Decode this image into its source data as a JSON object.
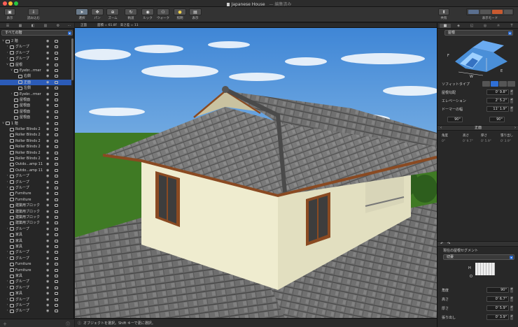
{
  "window": {
    "title": "Japanese House",
    "subtitle": "— 編集済み"
  },
  "toolbar": {
    "left_buttons": [
      {
        "label": "表示",
        "icon": "view-icon"
      },
      {
        "label": "読み込む",
        "icon": "import-icon"
      }
    ],
    "center_buttons": [
      {
        "label": "選択",
        "icon": "select-icon"
      },
      {
        "label": "パン",
        "icon": "pan-icon"
      },
      {
        "label": "ズーム",
        "icon": "zoom-icon"
      },
      {
        "label": "軌道",
        "icon": "orbit-icon"
      },
      {
        "label": "ルック",
        "icon": "look-icon"
      },
      {
        "label": "ウォーク",
        "icon": "walk-icon"
      },
      {
        "label": "照明",
        "icon": "lighting-icon"
      },
      {
        "label": "表示",
        "icon": "display-icon"
      }
    ],
    "right_buttons": [
      {
        "label": "共有",
        "icon": "share-icon"
      },
      {
        "label": "表示モード",
        "icon": "view-mode-icon"
      }
    ]
  },
  "left_panel": {
    "filter": "すべての階",
    "tree": [
      {
        "indent": 0,
        "tri": "∨",
        "label": "2 階",
        "selected": false
      },
      {
        "indent": 1,
        "tri": "›",
        "label": "グループ",
        "selected": false
      },
      {
        "indent": 1,
        "tri": "›",
        "label": "グループ",
        "selected": false
      },
      {
        "indent": 1,
        "tri": "›",
        "label": "グループ",
        "selected": false
      },
      {
        "indent": 1,
        "tri": "∨",
        "label": "屋根",
        "selected": false
      },
      {
        "indent": 2,
        "tri": "∨",
        "label": "Eyebr...rmer",
        "selected": false
      },
      {
        "indent": 3,
        "tri": "",
        "label": "右側",
        "selected": false
      },
      {
        "indent": 3,
        "tri": "",
        "label": "正面",
        "selected": true
      },
      {
        "indent": 3,
        "tri": "",
        "label": "左側",
        "selected": false
      },
      {
        "indent": 2,
        "tri": "›",
        "label": "Eyebr...rmer",
        "selected": false
      },
      {
        "indent": 2,
        "tri": "",
        "label": "屋根面",
        "selected": false
      },
      {
        "indent": 2,
        "tri": "",
        "label": "屋根面",
        "selected": false
      },
      {
        "indent": 2,
        "tri": "",
        "label": "屋根面",
        "selected": false
      },
      {
        "indent": 2,
        "tri": "",
        "label": "屋根面",
        "selected": false
      },
      {
        "indent": 0,
        "tri": "∨",
        "label": "1 階",
        "selected": false
      },
      {
        "indent": 1,
        "tri": "",
        "label": "Roller Blinds 2",
        "selected": false
      },
      {
        "indent": 1,
        "tri": "",
        "label": "Roller Blinds 2",
        "selected": false
      },
      {
        "indent": 1,
        "tri": "",
        "label": "Roller Blinds 2",
        "selected": false
      },
      {
        "indent": 1,
        "tri": "",
        "label": "Roller Blinds 2",
        "selected": false
      },
      {
        "indent": 1,
        "tri": "",
        "label": "Roller Blinds 2",
        "selected": false
      },
      {
        "indent": 1,
        "tri": "",
        "label": "Roller Blinds 2",
        "selected": false
      },
      {
        "indent": 1,
        "tri": "",
        "label": "Outdo...amp 11",
        "selected": false
      },
      {
        "indent": 1,
        "tri": "",
        "label": "Outdo...amp 11",
        "selected": false
      },
      {
        "indent": 1,
        "tri": "›",
        "label": "グループ",
        "selected": false
      },
      {
        "indent": 1,
        "tri": "›",
        "label": "グループ",
        "selected": false
      },
      {
        "indent": 1,
        "tri": "›",
        "label": "グループ",
        "selected": false
      },
      {
        "indent": 1,
        "tri": "",
        "label": "Furniture",
        "selected": false
      },
      {
        "indent": 1,
        "tri": "",
        "label": "Furniture",
        "selected": false
      },
      {
        "indent": 1,
        "tri": "",
        "label": "建築用ブロック",
        "selected": false
      },
      {
        "indent": 1,
        "tri": "",
        "label": "建築用ブロック",
        "selected": false
      },
      {
        "indent": 1,
        "tri": "",
        "label": "建築用ブロック",
        "selected": false
      },
      {
        "indent": 1,
        "tri": "",
        "label": "建築用ブロック",
        "selected": false
      },
      {
        "indent": 1,
        "tri": "›",
        "label": "グループ",
        "selected": false
      },
      {
        "indent": 1,
        "tri": "",
        "label": "家具",
        "selected": false
      },
      {
        "indent": 1,
        "tri": "",
        "label": "家具",
        "selected": false
      },
      {
        "indent": 1,
        "tri": "",
        "label": "家具",
        "selected": false
      },
      {
        "indent": 1,
        "tri": "›",
        "label": "グループ",
        "selected": false
      },
      {
        "indent": 1,
        "tri": "›",
        "label": "グループ",
        "selected": false
      },
      {
        "indent": 1,
        "tri": "",
        "label": "Furniture",
        "selected": false
      },
      {
        "indent": 1,
        "tri": "",
        "label": "Furniture",
        "selected": false
      },
      {
        "indent": 1,
        "tri": "",
        "label": "家具",
        "selected": false
      },
      {
        "indent": 1,
        "tri": "›",
        "label": "グループ",
        "selected": false
      },
      {
        "indent": 1,
        "tri": "›",
        "label": "グループ",
        "selected": false
      },
      {
        "indent": 1,
        "tri": "",
        "label": "家具",
        "selected": false
      },
      {
        "indent": 1,
        "tri": "›",
        "label": "グループ",
        "selected": false
      },
      {
        "indent": 1,
        "tri": "›",
        "label": "グループ",
        "selected": false
      },
      {
        "indent": 1,
        "tri": "›",
        "label": "グループ",
        "selected": false
      }
    ]
  },
  "viewport": {
    "header_name": "正面",
    "header_info": "面積 = 61.8F　高さ差 = 11"
  },
  "statusbar": {
    "text": "オブジェクトを選択。Shift キーで更に選択。"
  },
  "right_panel": {
    "object_type": "屋根",
    "diagram_labels": {
      "f": "F",
      "w": "W",
      "e": "E"
    },
    "soffit_label": "ソフィットタイプ",
    "properties": [
      {
        "label": "屋根勾配",
        "value": "0' 9.8\""
      },
      {
        "label": "エレベーション",
        "value": "2' 5.2\""
      },
      {
        "label": "ドーマーの幅",
        "value": "11' 1.9\""
      }
    ],
    "angle_left": "90°",
    "angle_right": "90°",
    "face_selector": "正面",
    "table_headers": [
      "角度",
      "高さ",
      "厚さ",
      "張り出し"
    ],
    "table_row": [
      "0°",
      "0' 9.7\"",
      "0' 5.9\"",
      "0' 3.9\""
    ],
    "segment_header": "現在の屋根セグメント",
    "segment_material": "切妻",
    "segment_dims": {
      "h": "H",
      "o": "O"
    },
    "segment_props": [
      {
        "label": "角度",
        "value": "90°"
      },
      {
        "label": "高さ",
        "value": "0' 6.7\""
      },
      {
        "label": "厚さ",
        "value": "0' 5.9\""
      },
      {
        "label": "張り出し",
        "value": "0' 3.9\""
      }
    ]
  },
  "colors": {
    "accent": "#2f6fd6",
    "selection": "#2b5bb8",
    "wall": "#efeccf",
    "trim": "#8a4a22",
    "roof": "#6d6d6d",
    "sky": "#4a8fd8",
    "grass": "#3f7a24"
  }
}
